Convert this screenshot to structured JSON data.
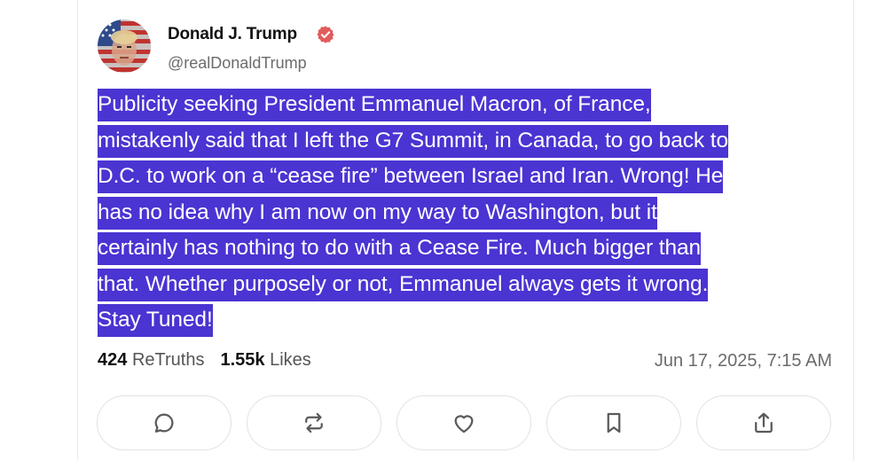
{
  "author": {
    "display_name": "Donald J. Trump",
    "handle": "@realDonaldTrump",
    "verified": true,
    "verified_color": "#e25c5c"
  },
  "post": {
    "lines": [
      "Publicity seeking President Emmanuel Macron, of France,",
      "mistakenly said that I left the G7 Summit, in Canada, to go back to",
      "D.C. to work on a “cease fire” between Israel and Iran. Wrong! He",
      "has no idea why I am now on my way to Washington, but it",
      "certainly has nothing to do with a Cease Fire. Much bigger than",
      "that. Whether purposely or not, Emmanuel always gets it wrong.",
      "Stay Tuned!"
    ],
    "selection_color": "#4a34d2"
  },
  "stats": {
    "retruths_count": "424",
    "retruths_label": "ReTruths",
    "likes_count": "1.55k",
    "likes_label": "Likes"
  },
  "timestamp": "Jun 17, 2025, 7:15 AM",
  "actions": [
    {
      "icon": "reply-icon"
    },
    {
      "icon": "retruth-icon"
    },
    {
      "icon": "heart-icon"
    },
    {
      "icon": "bookmark-icon"
    },
    {
      "icon": "share-icon"
    }
  ]
}
